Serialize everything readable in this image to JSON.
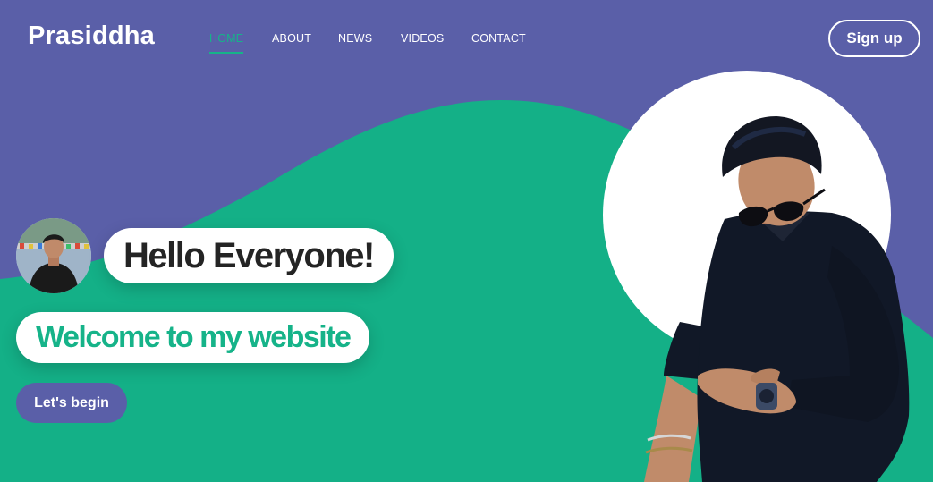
{
  "brand": {
    "name": "Prasiddha"
  },
  "nav": {
    "items": [
      {
        "label": "HOME",
        "active": true
      },
      {
        "label": "ABOUT",
        "active": false
      },
      {
        "label": "NEWS",
        "active": false
      },
      {
        "label": "VIDEOS",
        "active": false
      },
      {
        "label": "CONTACT",
        "active": false
      }
    ]
  },
  "header": {
    "signup_label": "Sign up"
  },
  "hero": {
    "greeting": "Hello Everyone!",
    "welcome": "Welcome to my website",
    "cta_label": "Let's begin"
  },
  "colors": {
    "background": "#5a5fa8",
    "wave": "#14b087",
    "accent": "#16b389",
    "text_dark": "#242424",
    "white": "#ffffff"
  }
}
